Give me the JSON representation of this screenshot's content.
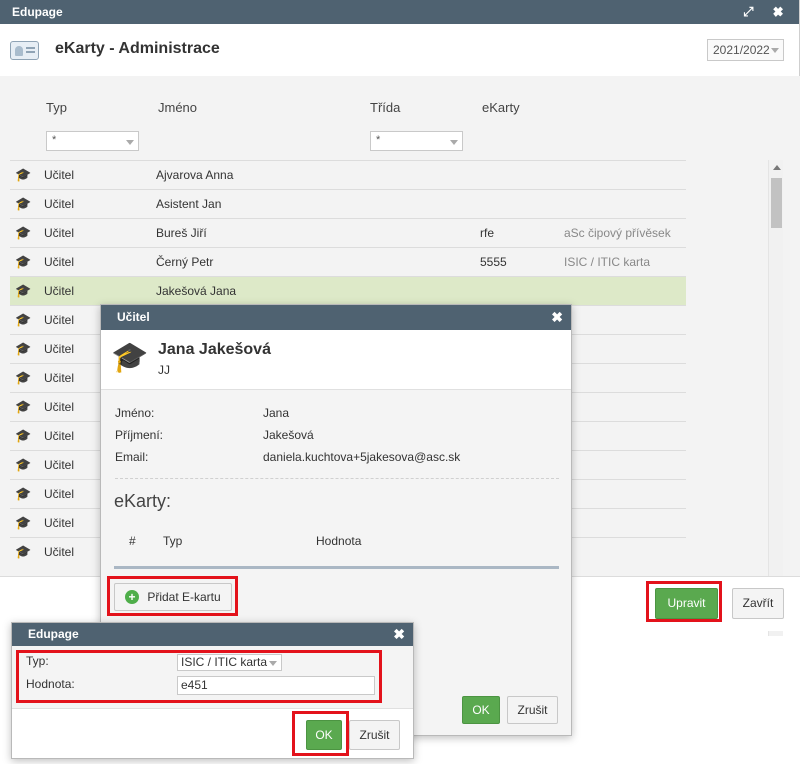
{
  "window": {
    "title": "Edupage",
    "controls": "⤢ ✖"
  },
  "header": {
    "title": "eKarty - Administrace",
    "year": "2021/2022"
  },
  "table": {
    "columns": [
      "Typ",
      "Jméno",
      "Třída",
      "eKarty"
    ],
    "filters": {
      "typ": "*",
      "trida": "*"
    },
    "rows": [
      {
        "typ": "Učitel",
        "jmeno": "Ajvarova Anna",
        "ekarty": "",
        "extra": ""
      },
      {
        "typ": "Učitel",
        "jmeno": "Asistent Jan",
        "ekarty": "",
        "extra": ""
      },
      {
        "typ": "Učitel",
        "jmeno": "Bureš Jiří",
        "ekarty": "rfe",
        "extra": "aSc čipový přívěsek"
      },
      {
        "typ": "Učitel",
        "jmeno": "Černý Petr",
        "ekarty": "5555",
        "extra": "ISIC / ITIC karta"
      },
      {
        "typ": "Učitel",
        "jmeno": "Jakešová Jana",
        "ekarty": "",
        "extra": ""
      },
      {
        "typ": "Učitel",
        "jmeno": "",
        "ekarty": "",
        "extra": ""
      },
      {
        "typ": "Učitel",
        "jmeno": "",
        "ekarty": "",
        "extra": ""
      },
      {
        "typ": "Učitel",
        "jmeno": "",
        "ekarty": "",
        "extra": ""
      },
      {
        "typ": "Učitel",
        "jmeno": "",
        "ekarty": "",
        "extra": ""
      },
      {
        "typ": "Učitel",
        "jmeno": "",
        "ekarty": "",
        "extra": ""
      },
      {
        "typ": "Učitel",
        "jmeno": "",
        "ekarty": "",
        "extra": ""
      },
      {
        "typ": "Učitel",
        "jmeno": "",
        "ekarty": "",
        "extra": ""
      },
      {
        "typ": "Učitel",
        "jmeno": "",
        "ekarty": "",
        "extra": ""
      },
      {
        "typ": "Učitel",
        "jmeno": "",
        "ekarty": "",
        "extra": ""
      }
    ]
  },
  "footer": {
    "edit": "Upravit",
    "close": "Zavřít"
  },
  "teacherDialog": {
    "title": "Učitel",
    "fullName": "Jana Jakešová",
    "initials": "JJ",
    "fields": [
      {
        "label": "Jméno:",
        "value": "Jana"
      },
      {
        "label": "Příjmení:",
        "value": "Jakešová"
      },
      {
        "label": "Email:",
        "value": "daniela.kuchtova+5jakesova@asc.sk"
      }
    ],
    "ekartyHeading": "eKarty:",
    "ekartyColumns": [
      "#",
      "Typ",
      "Hodnota"
    ],
    "addButton": "Přidat E-kartu",
    "ok": "OK",
    "cancel": "Zrušit"
  },
  "cardDialog": {
    "title": "Edupage",
    "typLabel": "Typ:",
    "typValue": "ISIC / ITIC karta",
    "hodnotaLabel": "Hodnota:",
    "hodnotaValue": "e451",
    "ok": "OK",
    "cancel": "Zrušit"
  },
  "colors": {
    "titlebar": "#4f6271",
    "accent": "#5aa94f",
    "selectedRow": "#dde9c8",
    "highlight": "#e3121b"
  },
  "icons": {
    "card": "id-card-icon",
    "teacher": "graduation-cap-icon",
    "add": "plus-circle-icon"
  }
}
